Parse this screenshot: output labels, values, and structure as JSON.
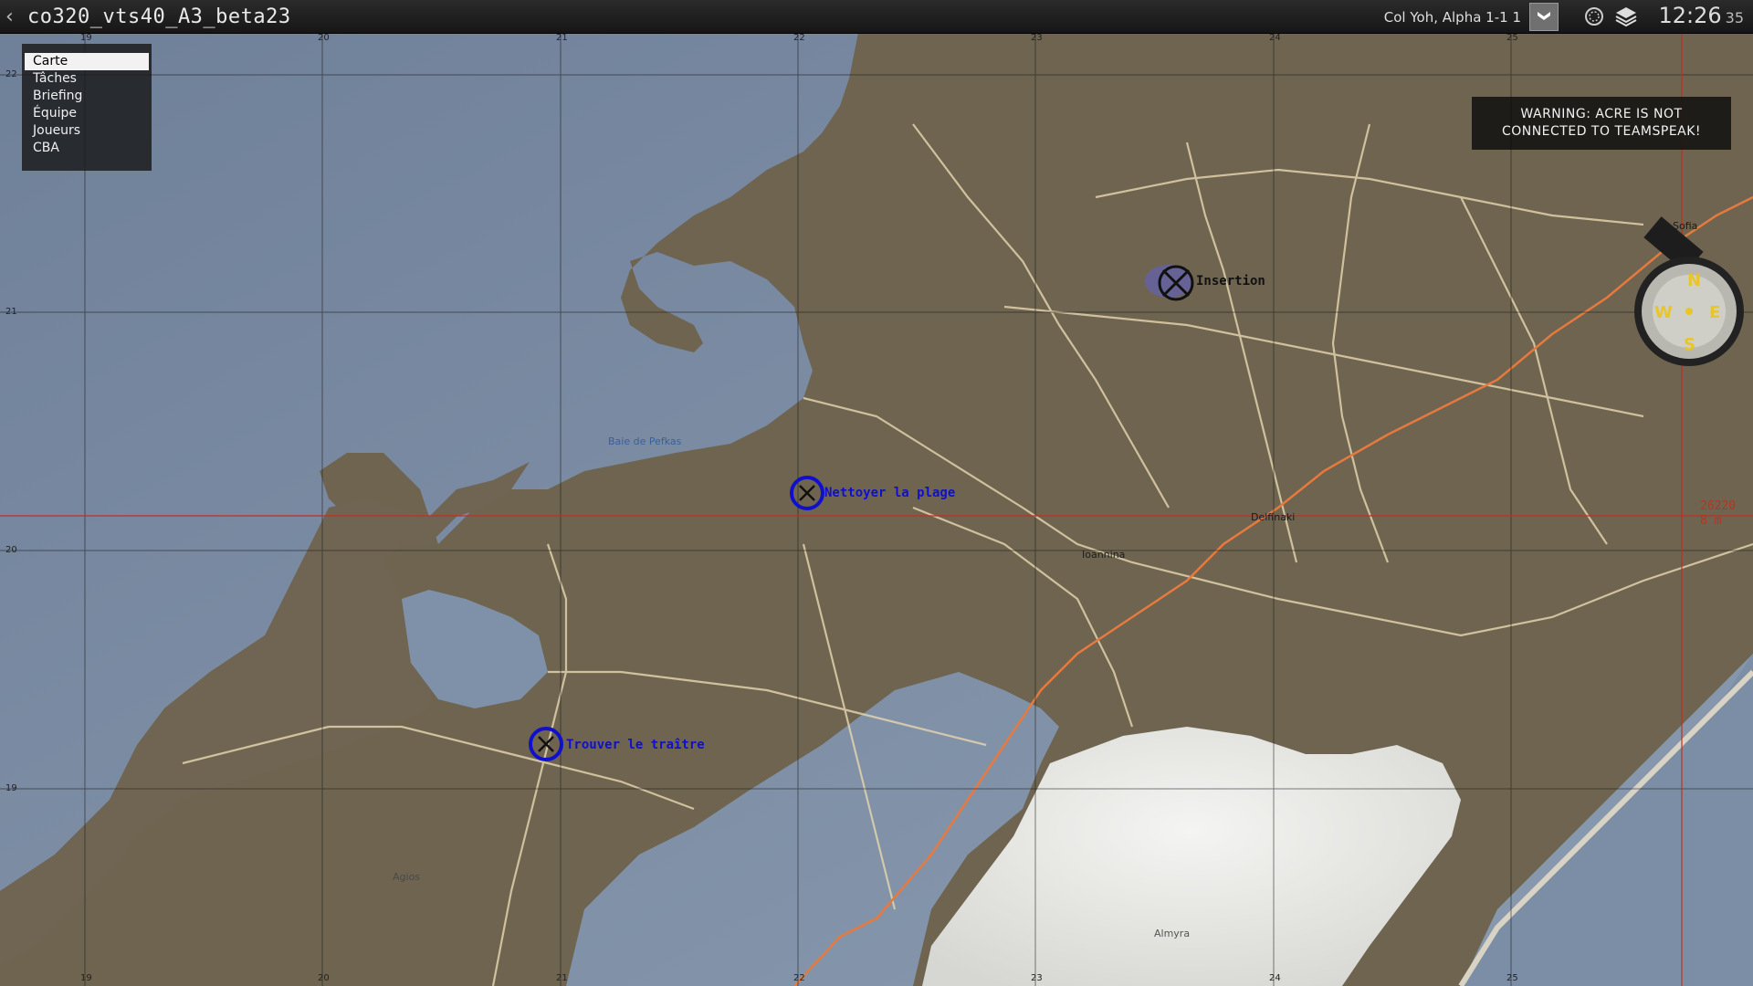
{
  "topbar": {
    "mission_title": "co320_vts40_A3_beta23",
    "player": "Col Yoh, Alpha 1-1 1",
    "time_main": "12:26",
    "time_seconds": "35"
  },
  "menu": {
    "items": [
      "Carte",
      "Tâches",
      "Briefing",
      "Équipe",
      "Joueurs",
      "CBA"
    ],
    "active": "Carte"
  },
  "warning": {
    "line1": "WARNING: ACRE IS NOT",
    "line2": "CONNECTED TO TEAMSPEAK!"
  },
  "tasks": {
    "insertion": "Insertion",
    "nettoyer": "Nettoyer la plage",
    "trouver": "Trouver le traître"
  },
  "places": {
    "sofia": "Sofia",
    "bay": "Baie de Pefkas",
    "ioannina": "Ioannina",
    "delfinaki": "Delfinaki",
    "almyra": "Almyra",
    "agios": "Agios"
  },
  "grid": {
    "x_labels": [
      "19",
      "20",
      "21",
      "22",
      "23",
      "24",
      "25"
    ],
    "y_labels": [
      "22",
      "21",
      "20",
      "19"
    ]
  },
  "readout": {
    "line1": "26220",
    "line2": "8 m"
  },
  "colors": {
    "sea": "#7c8ea5",
    "land": "#6e6450",
    "task_blue": "#1010cc",
    "road": "#e2d2ac",
    "red_line": "#c0301f",
    "rail": "#e67a3e"
  },
  "icons": {
    "back": "chevron-left-icon",
    "rank": "rank-chevron-icon",
    "gps": "gps-icon",
    "layers": "layers-icon",
    "compass": "compass-icon"
  }
}
